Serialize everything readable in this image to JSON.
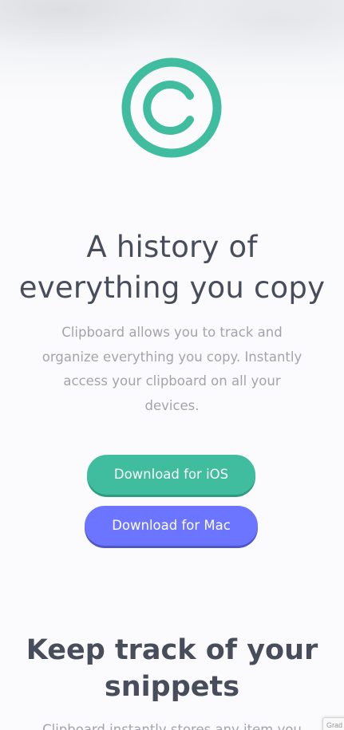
{
  "hero": {
    "logo_icon": "copyright-c-icon",
    "logo_color": "#3fbd9e",
    "title_line1": "A history of",
    "title_line2": "everything you copy",
    "description": "Clipboard allows you to track and organize everything you copy. Instantly access your clipboard on all your devices."
  },
  "buttons": {
    "ios_label": "Download for iOS",
    "ios_color": "#3fbd9e",
    "mac_label": "Download for Mac",
    "mac_color": "#6b75ff"
  },
  "snippets": {
    "title_line1": "Keep track of your",
    "title_line2": "snippets",
    "description_partial": "Clipboard instantly stores any item you"
  },
  "recaptcha_badge": {
    "label": "Grad",
    "icon": "recaptcha-icon"
  }
}
